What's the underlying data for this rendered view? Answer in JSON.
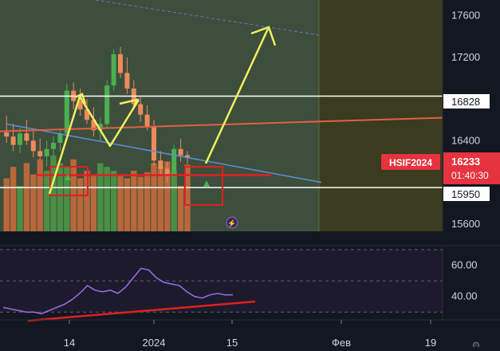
{
  "symbol": "HSIF2024",
  "last_price": "16233",
  "countdown": "01:40:30",
  "level_labels": {
    "upper": "16828",
    "lower": "15950"
  },
  "colors": {
    "background": "#131722",
    "zone_green": "#3d4e3d",
    "zone_olive": "#3a3b1f",
    "candle_up": "#4caf50",
    "candle_down": "#ef8a5b",
    "volume_up": "#4a8f44",
    "volume_down": "#b8683b",
    "trend_line": "#5b8fd6",
    "resistance_line": "#e0623f",
    "support_line": "#e02020",
    "annotation": "#f0f060",
    "rsi_line": "#9a6ee8",
    "price_label_bg": "#e5333f"
  },
  "chart_data": [
    {
      "type": "candlestick",
      "title": "",
      "y_axis_ticks": [
        15600,
        16000,
        16400,
        16800,
        17200,
        17600
      ],
      "y_axis_labels": [
        "15600",
        "16400",
        "17200",
        "17600"
      ],
      "ylim": [
        15530,
        17750
      ],
      "x_axis_ticks": [
        "14",
        "2024",
        "15",
        "Фев",
        "19"
      ],
      "horizontal_levels": [
        16828,
        15950
      ],
      "candles": [
        {
          "o": 16480,
          "h": 16640,
          "l": 16380,
          "c": 16440
        },
        {
          "o": 16440,
          "h": 16560,
          "l": 16300,
          "c": 16360
        },
        {
          "o": 16360,
          "h": 16520,
          "l": 16280,
          "c": 16470
        },
        {
          "o": 16470,
          "h": 16600,
          "l": 16360,
          "c": 16400
        },
        {
          "o": 16400,
          "h": 16500,
          "l": 16240,
          "c": 16300
        },
        {
          "o": 16300,
          "h": 16420,
          "l": 16220,
          "c": 16250
        },
        {
          "o": 16250,
          "h": 16400,
          "l": 16150,
          "c": 16320
        },
        {
          "o": 16320,
          "h": 16440,
          "l": 16250,
          "c": 16380
        },
        {
          "o": 16380,
          "h": 16520,
          "l": 16300,
          "c": 16470
        },
        {
          "o": 16470,
          "h": 16950,
          "l": 16420,
          "c": 16880
        },
        {
          "o": 16880,
          "h": 16960,
          "l": 16700,
          "c": 16780
        },
        {
          "o": 16780,
          "h": 16900,
          "l": 16640,
          "c": 16700
        },
        {
          "o": 16700,
          "h": 16800,
          "l": 16560,
          "c": 16600
        },
        {
          "o": 16600,
          "h": 16720,
          "l": 16440,
          "c": 16500
        },
        {
          "o": 16500,
          "h": 16620,
          "l": 16400,
          "c": 16560
        },
        {
          "o": 16560,
          "h": 16980,
          "l": 16520,
          "c": 16930
        },
        {
          "o": 16930,
          "h": 17280,
          "l": 16880,
          "c": 17230
        },
        {
          "o": 17230,
          "h": 17300,
          "l": 17000,
          "c": 17050
        },
        {
          "o": 17050,
          "h": 17200,
          "l": 16850,
          "c": 16900
        },
        {
          "o": 16900,
          "h": 16980,
          "l": 16700,
          "c": 16750
        },
        {
          "o": 16750,
          "h": 16820,
          "l": 16580,
          "c": 16650
        },
        {
          "o": 16650,
          "h": 16740,
          "l": 16500,
          "c": 16540
        },
        {
          "o": 16540,
          "h": 16600,
          "l": 16160,
          "c": 16210
        },
        {
          "o": 16210,
          "h": 16300,
          "l": 16060,
          "c": 16130
        },
        {
          "o": 16130,
          "h": 16200,
          "l": 16000,
          "c": 16060
        },
        {
          "o": 16060,
          "h": 16360,
          "l": 16040,
          "c": 16320
        },
        {
          "o": 16320,
          "h": 16420,
          "l": 16200,
          "c": 16260
        },
        {
          "o": 16260,
          "h": 16300,
          "l": 16180,
          "c": 16233
        }
      ],
      "volume_relative": [
        0.7,
        0.85,
        0.6,
        0.9,
        0.75,
        0.95,
        0.8,
        1.0,
        0.9,
        0.85,
        0.95,
        0.7,
        0.8,
        0.75,
        0.9,
        0.85,
        0.8,
        0.75,
        0.7,
        0.8,
        0.72,
        0.78,
        0.9,
        0.85,
        0.92,
        0.8,
        0.6,
        0.88
      ],
      "trend_line": {
        "from": {
          "candle": 0,
          "price": 16560
        },
        "to": {
          "candle": 47,
          "price": 16000
        }
      },
      "resistance_line": {
        "from": {
          "candle": 0,
          "price": 16490
        },
        "to": {
          "candle": 65,
          "price": 16620
        }
      },
      "support_line_price": 16070
    },
    {
      "type": "line",
      "title": "",
      "y_axis_labels": [
        "60.00",
        "40.00"
      ],
      "ylim": [
        25,
        72
      ],
      "levels": [
        30,
        50,
        70
      ],
      "values": [
        33,
        32,
        31,
        30,
        30,
        29,
        31,
        33,
        35,
        38,
        42,
        47,
        44,
        43,
        44,
        42,
        46,
        52,
        58,
        57,
        52,
        49,
        48,
        47,
        43,
        40,
        39,
        41,
        42,
        41,
        41
      ]
    }
  ],
  "tv_logo_glyph": "⚡",
  "settings_glyph": "⚙"
}
